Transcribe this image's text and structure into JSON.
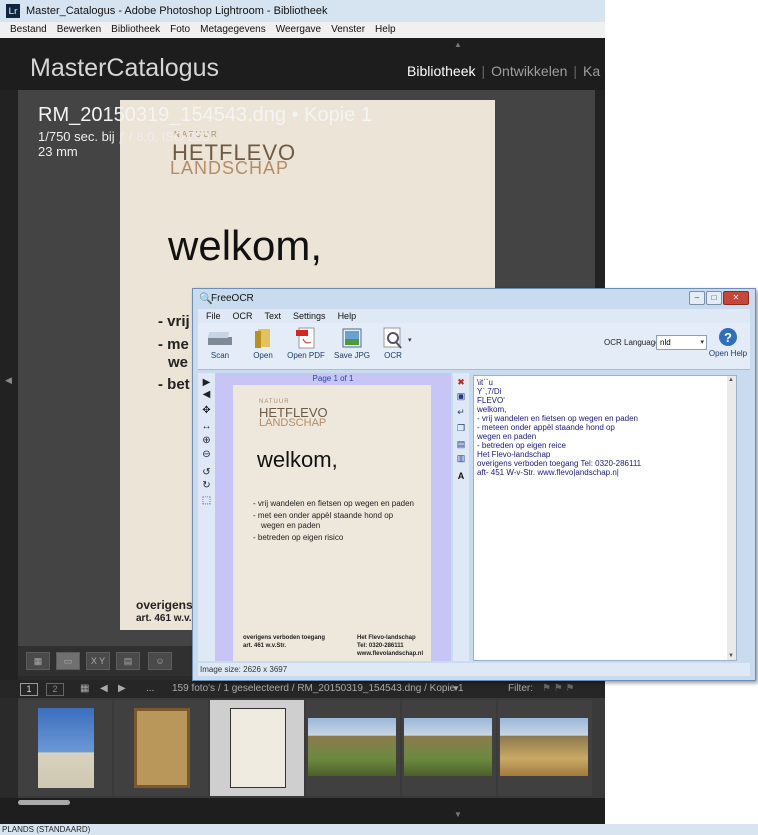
{
  "lightroom": {
    "title": "Master_Catalogus - Adobe Photoshop Lightroom - Bibliotheek",
    "app_icon": "Lr",
    "menu": [
      "Bestand",
      "Bewerken",
      "Bibliotheek",
      "Foto",
      "Metagegevens",
      "Weergave",
      "Venster",
      "Help"
    ],
    "catalog_name": "MasterCatalogus",
    "modules": {
      "active": "Bibliotheek",
      "next": "Ontwikkelen",
      "partial": "Ka"
    },
    "photo_info": {
      "filename": "RM_20150319_154543.dng  •  Kopie 1",
      "exposure": "1/750 sec. bij ƒ / 8,0, ISO 200",
      "focal": "23 mm"
    },
    "photo_text": {
      "logo_small": "NATUUR",
      "logo_line1": "HETFLEVO",
      "logo_line2": "LANDSCHAP",
      "welcome": "welkom,",
      "bullets": [
        "- vrij",
        "- me",
        "we",
        "- bet"
      ],
      "footer1": "overigens v",
      "footer2": "art. 461 w.v."
    },
    "toolbar": {
      "compare": "X Y"
    },
    "filmstrip": {
      "page1": "1",
      "page2": "2",
      "ellipsis": "...",
      "status": "159 foto's / 1 geselecteerd / RM_20150319_154543.dng / Kopie 1",
      "filter_label": "Filter:"
    },
    "statusbar": "PLANDS (STANDAARD)"
  },
  "ocr": {
    "title": "FreeOCR",
    "menu": [
      "File",
      "OCR",
      "Text",
      "Settings",
      "Help"
    ],
    "ribbon": {
      "scan": "Scan",
      "open": "Open",
      "open_pdf": "Open PDF",
      "save_jpg": "Save JPG",
      "ocr": "OCR",
      "ocr_lang_label": "OCR Language:",
      "ocr_lang_value": "nld",
      "open_help": "Open Help"
    },
    "page_label": "Page 1 of 1",
    "doc": {
      "l1": "NATUUR",
      "l2": "HETFLEVO",
      "l3": "LANDSCHAP",
      "welkom": "welkom,",
      "b1": "- vrij wandelen en fietsen op wegen en paden",
      "b2": "- met een onder appèl staande hond op",
      "b3": "wegen en paden",
      "b4": "- betreden op eigen risico",
      "f1": "overigens verboden toegang",
      "f2": "art. 461 w.v.Str.",
      "f3": "Het Flevo-landschap",
      "f4": "Tel: 0320-286111",
      "f5": "www.flevolandschap.nl"
    },
    "text_lines": [
      "\\it``u",
      "Y`,7/Di",
      "FLEVO'",
      "welkom,",
      "- vrij wandelen en fietsen op wegen en paden",
      "- meteen onder appèl staande hond op",
      "wegen en paden",
      "- betreden op eigen reice",
      "Het Flevo-landschap",
      "overigens verboden toegang Tel: 0320-286111",
      "aft- 451 W-v-Str. www.flevo|andschap.n|"
    ],
    "status": "Image size:  2626 x  3697"
  }
}
